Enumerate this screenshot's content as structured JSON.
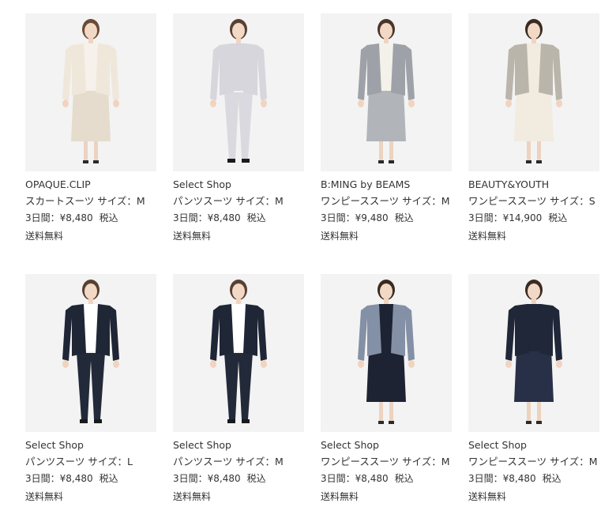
{
  "products": [
    {
      "brand": "OPAQUE.CLIP",
      "type_size": "スカートスーツ サイズ：M",
      "period_price": "3日間：¥8,480",
      "tax": "税込",
      "shipping": "送料無料",
      "image_icon": "model-skirt-suit-beige-icon",
      "colors": {
        "top": "#efe7da",
        "bottom": "#e5dccd",
        "inner": "#f6f1ea",
        "hair": "#6a4b36",
        "bg": "#f3f3f3"
      }
    },
    {
      "brand": "Select Shop",
      "type_size": "パンツスーツ サイズ：M",
      "period_price": "3日間：¥8,480",
      "tax": "税込",
      "shipping": "送料無料",
      "image_icon": "model-pants-suit-gray-icon",
      "colors": {
        "top": "#d6d6dc",
        "bottom": "#d9d9df",
        "inner": "#d6d6dc",
        "hair": "#5a4032",
        "bg": "#f3f3f3"
      }
    },
    {
      "brand": "B:MING by BEAMS",
      "type_size": "ワンピーススーツ サイズ：M",
      "period_price": "3日間：¥9,480",
      "tax": "税込",
      "shipping": "送料無料",
      "image_icon": "model-tweed-dress-suit-icon",
      "colors": {
        "top": "#9ea2a8",
        "bottom": "#b1b4b9",
        "inner": "#f4f1ea",
        "hair": "#4b3528",
        "bg": "#f3f3f3"
      }
    },
    {
      "brand": "BEAUTY&YOUTH",
      "type_size": "ワンピーススーツ サイズ：S",
      "period_price": "3日間：¥14,900",
      "tax": "税込",
      "shipping": "送料無料",
      "image_icon": "model-tweed-jacket-cream-dress-icon",
      "colors": {
        "top": "#b9b5ab",
        "bottom": "#f1ebe0",
        "inner": "#f1ebe0",
        "hair": "#3b2a20",
        "bg": "#f3f3f3"
      }
    },
    {
      "brand": "Select Shop",
      "type_size": "パンツスーツ サイズ：L",
      "period_price": "3日間：¥8,480",
      "tax": "税込",
      "shipping": "送料無料",
      "image_icon": "model-pants-suit-navy-icon",
      "colors": {
        "top": "#1f2636",
        "bottom": "#222a3a",
        "inner": "#ffffff",
        "hair": "#5a4032",
        "bg": "#f3f3f3"
      }
    },
    {
      "brand": "Select Shop",
      "type_size": "パンツスーツ サイズ：M",
      "period_price": "3日間：¥8,480",
      "tax": "税込",
      "shipping": "送料無料",
      "image_icon": "model-pants-suit-navy-icon",
      "colors": {
        "top": "#1f2636",
        "bottom": "#222a3a",
        "inner": "#ffffff",
        "hair": "#5a4032",
        "bg": "#f3f3f3"
      }
    },
    {
      "brand": "Select Shop",
      "type_size": "ワンピーススーツ サイズ：M",
      "period_price": "3日間：¥8,480",
      "tax": "税込",
      "shipping": "送料無料",
      "image_icon": "model-tweed-jacket-navy-dress-icon",
      "colors": {
        "top": "#8390a6",
        "bottom": "#1d2333",
        "inner": "#1d2333",
        "hair": "#3b2a20",
        "bg": "#f3f3f3"
      }
    },
    {
      "brand": "Select Shop",
      "type_size": "ワンピーススーツ サイズ：M",
      "period_price": "3日間：¥8,480",
      "tax": "税込",
      "shipping": "送料無料",
      "image_icon": "model-navy-lace-dress-suit-icon",
      "colors": {
        "top": "#1f2738",
        "bottom": "#283047",
        "inner": "#1f2738",
        "hair": "#3b2a20",
        "bg": "#f3f3f3"
      }
    }
  ]
}
